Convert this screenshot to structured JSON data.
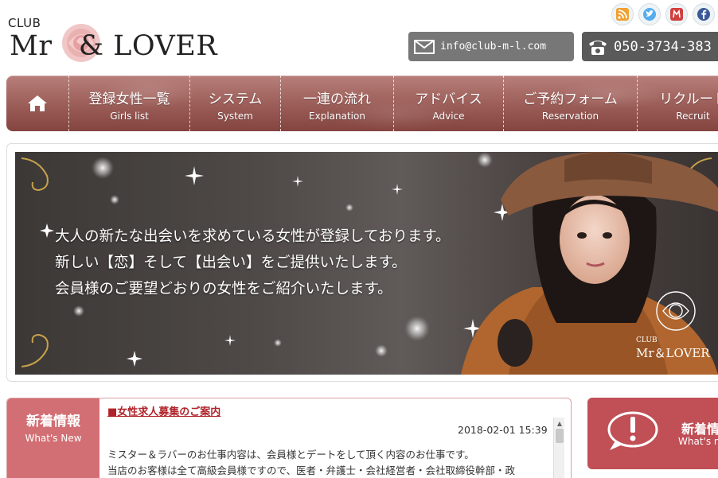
{
  "header": {
    "logo": {
      "club": "CLUB",
      "name_left": "Mr",
      "amp": "&",
      "name_right": "LOVER"
    },
    "social": [
      {
        "icon": "rss-icon",
        "color": "#f0a030"
      },
      {
        "icon": "twitter-icon",
        "color": "#55acee"
      },
      {
        "icon": "mixi-icon",
        "color": "#d04040"
      },
      {
        "icon": "facebook-icon",
        "color": "#3b5998"
      }
    ],
    "mail_label": "info@club-m-l.com",
    "tel_label": "050-3734-383"
  },
  "nav": {
    "items": [
      {
        "jp": "登録女性一覧",
        "en": "Girls list"
      },
      {
        "jp": "システム",
        "en": "System"
      },
      {
        "jp": "一連の流れ",
        "en": "Explanation"
      },
      {
        "jp": "アドバイス",
        "en": "Advice"
      },
      {
        "jp": "ご予約フォーム",
        "en": "Reservation"
      },
      {
        "jp": "リクルート",
        "en": "Recruit"
      }
    ]
  },
  "banner": {
    "line1": "大人の新たな出会いを求めている女性が登録しております。",
    "line2": "新しい【恋】そして【出会い】をご提供いたします。",
    "line3": "会員様のご要望どおりの女性をご紹介いたします。",
    "logo_club": "CLUB",
    "logo_name": "Mr＆LOVER"
  },
  "news": {
    "label_jp": "新着情報",
    "label_en": "What's New",
    "title": "■女性求人募集のご案内",
    "date": "2018-02-01 15:39",
    "body_line1": "ミスター＆ラバーのお仕事内容は、会員様とデートをして頂く内容のお仕事です。",
    "body_line2": "当店のお客様は全て高級会員様ですので、医者・弁護士・会社経営者・会社取締役幹部・政"
  },
  "side_news": {
    "label_jp": "新着情",
    "label_en": "What's n"
  },
  "colors": {
    "nav": "#9d5f5a",
    "news_label": "#d26f74",
    "accent": "#b0232a"
  }
}
